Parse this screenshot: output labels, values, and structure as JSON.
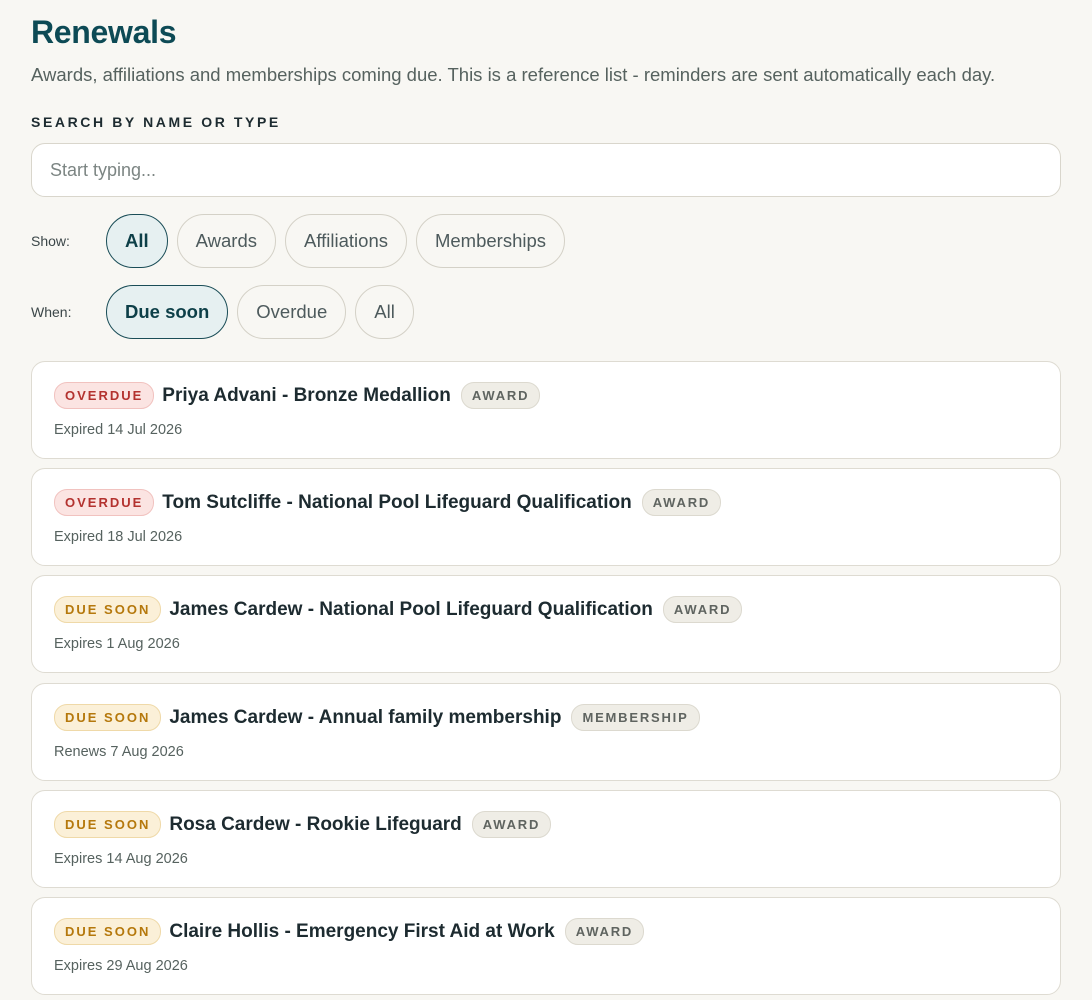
{
  "header": {
    "title": "Renewals",
    "subtitle": "Awards, affiliations and memberships coming due. This is a reference list - reminders are sent automatically each day."
  },
  "search": {
    "label": "SEARCH BY NAME OR TYPE",
    "placeholder": "Start typing...",
    "value": ""
  },
  "filters": {
    "show": {
      "label": "Show:",
      "options": [
        "All",
        "Awards",
        "Affiliations",
        "Memberships"
      ],
      "selected": "All"
    },
    "when": {
      "label": "When:",
      "options": [
        "Due soon",
        "Overdue",
        "All"
      ],
      "selected": "Due soon"
    }
  },
  "renewals": [
    {
      "status": "OVERDUE",
      "title": "Priya Advani - Bronze Medallion",
      "type": "AWARD",
      "date": "Expired 14 Jul 2026"
    },
    {
      "status": "OVERDUE",
      "title": "Tom Sutcliffe - National Pool Lifeguard Qualification",
      "type": "AWARD",
      "date": "Expired 18 Jul 2026"
    },
    {
      "status": "DUE SOON",
      "title": "James Cardew - National Pool Lifeguard Qualification",
      "type": "AWARD",
      "date": "Expires 1 Aug 2026"
    },
    {
      "status": "DUE SOON",
      "title": "James Cardew - Annual family membership",
      "type": "MEMBERSHIP",
      "date": "Renews 7 Aug 2026"
    },
    {
      "status": "DUE SOON",
      "title": "Rosa Cardew - Rookie Lifeguard",
      "type": "AWARD",
      "date": "Expires 14 Aug 2026"
    },
    {
      "status": "DUE SOON",
      "title": "Claire Hollis - Emergency First Aid at Work",
      "type": "AWARD",
      "date": "Expires 29 Aug 2026"
    }
  ],
  "colors": {
    "title": "#0d4a55",
    "background": "#f8f7f3",
    "overdue": "#b3322f",
    "due_soon": "#b5780c",
    "active_pill_border": "#1a4d57"
  }
}
